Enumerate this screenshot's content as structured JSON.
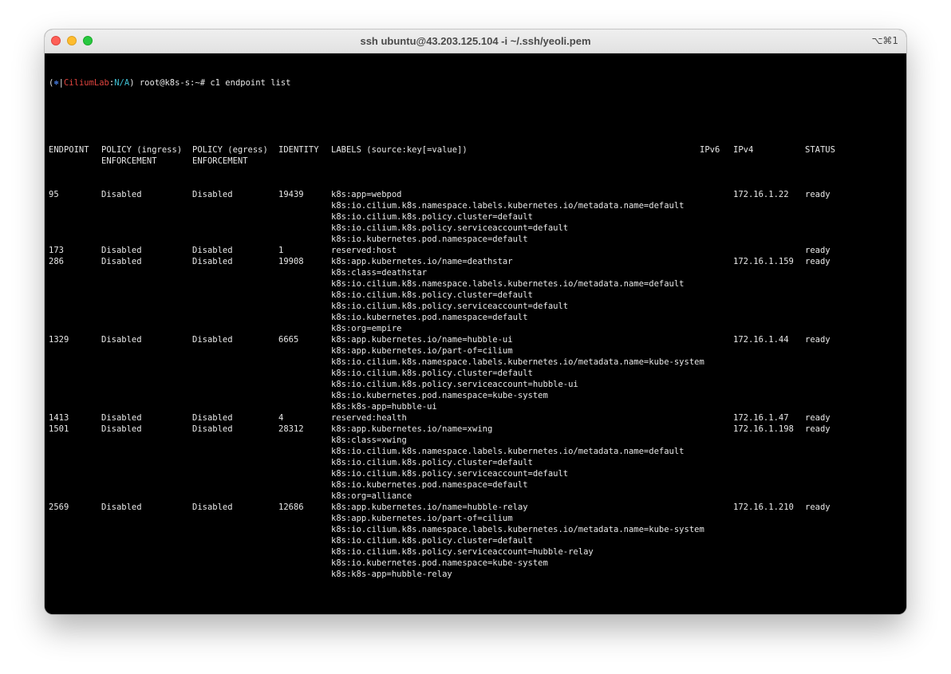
{
  "window": {
    "title": "ssh ubuntu@43.203.125.104 -i ~/.ssh/yeoli.pem",
    "shortcut": "⌥⌘1"
  },
  "prompt": {
    "open_paren": "(",
    "symbol": "⎈",
    "separator": "|",
    "context": "CiliumLab",
    "colon": ":",
    "namespace": "N/A",
    "close": ") root@k8s-s:~# "
  },
  "command": "c1 endpoint list",
  "table": {
    "headers": {
      "endpoint": "ENDPOINT",
      "ingress": "POLICY (ingress)\nENFORCEMENT",
      "egress": "POLICY (egress)\nENFORCEMENT",
      "identity": "IDENTITY",
      "labels": "LABELS (source:key[=value])",
      "ipv6": "IPv6",
      "ipv4": "IPv4",
      "status": "STATUS"
    },
    "rows": [
      {
        "endpoint": "95",
        "ingress": "Disabled",
        "egress": "Disabled",
        "identity": "19439",
        "labels": [
          "k8s:app=webpod",
          "k8s:io.cilium.k8s.namespace.labels.kubernetes.io/metadata.name=default",
          "k8s:io.cilium.k8s.policy.cluster=default",
          "k8s:io.cilium.k8s.policy.serviceaccount=default",
          "k8s:io.kubernetes.pod.namespace=default"
        ],
        "ipv6": "",
        "ipv4": "172.16.1.22",
        "status": "ready"
      },
      {
        "endpoint": "173",
        "ingress": "Disabled",
        "egress": "Disabled",
        "identity": "1",
        "labels": [
          "reserved:host"
        ],
        "ipv6": "",
        "ipv4": "",
        "status": "ready"
      },
      {
        "endpoint": "286",
        "ingress": "Disabled",
        "egress": "Disabled",
        "identity": "19908",
        "labels": [
          "k8s:app.kubernetes.io/name=deathstar",
          "k8s:class=deathstar",
          "k8s:io.cilium.k8s.namespace.labels.kubernetes.io/metadata.name=default",
          "k8s:io.cilium.k8s.policy.cluster=default",
          "k8s:io.cilium.k8s.policy.serviceaccount=default",
          "k8s:io.kubernetes.pod.namespace=default",
          "k8s:org=empire"
        ],
        "ipv6": "",
        "ipv4": "172.16.1.159",
        "status": "ready"
      },
      {
        "endpoint": "1329",
        "ingress": "Disabled",
        "egress": "Disabled",
        "identity": "6665",
        "labels": [
          "k8s:app.kubernetes.io/name=hubble-ui",
          "k8s:app.kubernetes.io/part-of=cilium",
          "k8s:io.cilium.k8s.namespace.labels.kubernetes.io/metadata.name=kube-system",
          "k8s:io.cilium.k8s.policy.cluster=default",
          "k8s:io.cilium.k8s.policy.serviceaccount=hubble-ui",
          "k8s:io.kubernetes.pod.namespace=kube-system",
          "k8s:k8s-app=hubble-ui"
        ],
        "ipv6": "",
        "ipv4": "172.16.1.44",
        "status": "ready"
      },
      {
        "endpoint": "1413",
        "ingress": "Disabled",
        "egress": "Disabled",
        "identity": "4",
        "labels": [
          "reserved:health"
        ],
        "ipv6": "",
        "ipv4": "172.16.1.47",
        "status": "ready"
      },
      {
        "endpoint": "1501",
        "ingress": "Disabled",
        "egress": "Disabled",
        "identity": "28312",
        "labels": [
          "k8s:app.kubernetes.io/name=xwing",
          "k8s:class=xwing",
          "k8s:io.cilium.k8s.namespace.labels.kubernetes.io/metadata.name=default",
          "k8s:io.cilium.k8s.policy.cluster=default",
          "k8s:io.cilium.k8s.policy.serviceaccount=default",
          "k8s:io.kubernetes.pod.namespace=default",
          "k8s:org=alliance"
        ],
        "ipv6": "",
        "ipv4": "172.16.1.198",
        "status": "ready"
      },
      {
        "endpoint": "2569",
        "ingress": "Disabled",
        "egress": "Disabled",
        "identity": "12686",
        "labels": [
          "k8s:app.kubernetes.io/name=hubble-relay",
          "k8s:app.kubernetes.io/part-of=cilium",
          "k8s:io.cilium.k8s.namespace.labels.kubernetes.io/metadata.name=kube-system",
          "k8s:io.cilium.k8s.policy.cluster=default",
          "k8s:io.cilium.k8s.policy.serviceaccount=hubble-relay",
          "k8s:io.kubernetes.pod.namespace=kube-system",
          "k8s:k8s-app=hubble-relay"
        ],
        "ipv6": "",
        "ipv4": "172.16.1.210",
        "status": "ready"
      }
    ]
  },
  "colors": {
    "background": "#000000",
    "text": "#e8e8e8",
    "prompt_symbol": "#4f8cff",
    "prompt_context": "#e0443e",
    "prompt_namespace": "#3fc3d6"
  }
}
